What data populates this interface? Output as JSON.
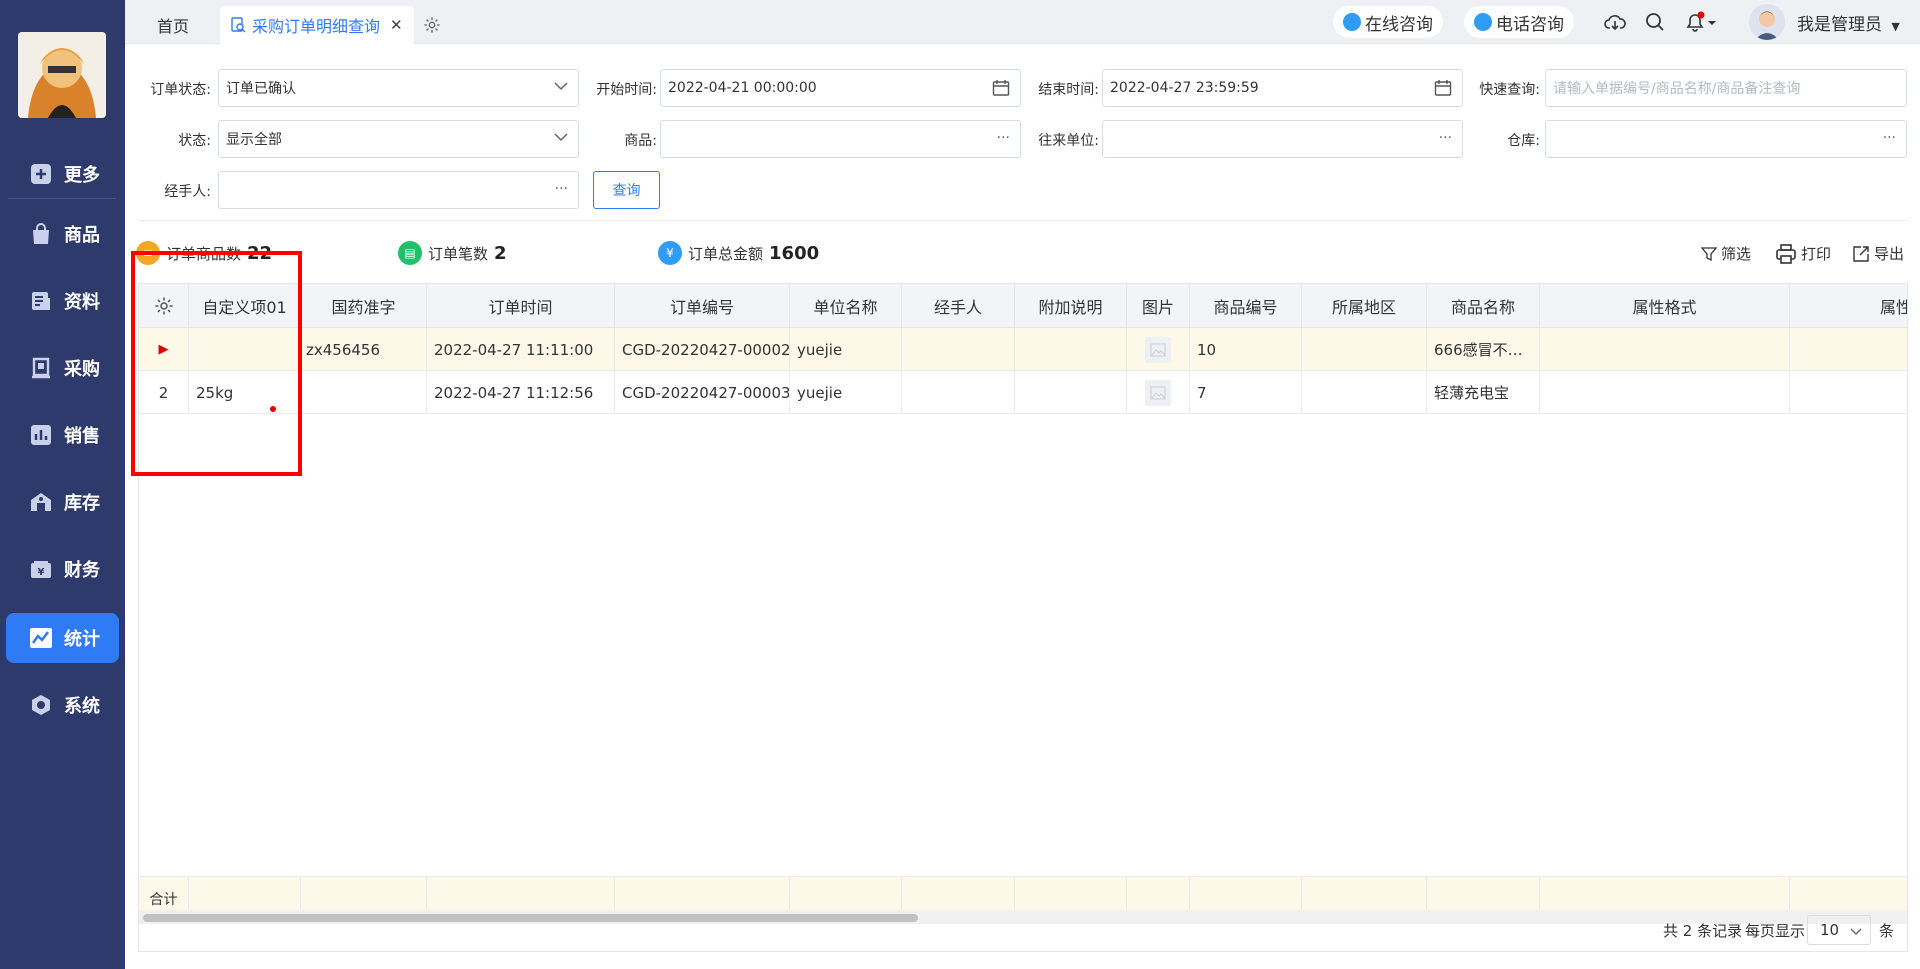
{
  "sidebar": {
    "items": [
      {
        "label": "更多",
        "icon": "plus-square-icon"
      },
      {
        "label": "商品",
        "icon": "shopping-bag-icon"
      },
      {
        "label": "资料",
        "icon": "document-icon"
      },
      {
        "label": "采购",
        "icon": "purchase-icon"
      },
      {
        "label": "销售",
        "icon": "bar-chart-icon"
      },
      {
        "label": "库存",
        "icon": "warehouse-icon"
      },
      {
        "label": "财务",
        "icon": "finance-icon"
      },
      {
        "label": "统计",
        "icon": "statistics-icon"
      },
      {
        "label": "系统",
        "icon": "settings-hex-icon"
      }
    ],
    "active": "统计"
  },
  "topbar": {
    "home_tab": "首页",
    "active_tab": "采购订单明细查询",
    "online_consult": "在线咨询",
    "phone_consult": "电话咨询",
    "user_name": "我是管理员"
  },
  "filters": {
    "order_status_label": "订单状态:",
    "order_status_value": "订单已确认",
    "start_time_label": "开始时间:",
    "start_time_value": "2022-04-21 00:00:00",
    "end_time_label": "结束时间:",
    "end_time_value": "2022-04-27 23:59:59",
    "quick_query_label": "快速查询:",
    "quick_query_placeholder": "请输入单据编号/商品名称/商品备注查询",
    "status_label": "状态:",
    "status_value": "显示全部",
    "goods_label": "商品:",
    "partner_label": "往来单位:",
    "warehouse_label": "仓库:",
    "handler_label": "经手人:",
    "query_button": "查询"
  },
  "stats": {
    "goods_count_label": "订单商品数",
    "goods_count": "22",
    "order_count_label": "订单笔数",
    "order_count": "2",
    "total_amount_label": "订单总金额",
    "total_amount": "1600"
  },
  "actions": {
    "filter": "筛选",
    "print": "打印",
    "export": "导出"
  },
  "table": {
    "headers": [
      "自定义项01",
      "国药准字",
      "订单时间",
      "订单编号",
      "单位名称",
      "经手人",
      "附加说明",
      "图片",
      "商品编号",
      "所属地区",
      "商品名称",
      "属性格式",
      "属性"
    ],
    "rows": [
      {
        "index": "",
        "custom01": "",
        "guoyao": "zx456456",
        "time": "2022-04-27 11:11:00",
        "order_no": "CGD-20220427-00002",
        "unit": "yuejie",
        "handler": "",
        "note": "",
        "goods_no": "10",
        "region": "",
        "goods_name": "666感冒不…",
        "attr": ""
      },
      {
        "index": "2",
        "custom01": "25kg",
        "guoyao": "",
        "time": "2022-04-27 11:12:56",
        "order_no": "CGD-20220427-00003",
        "unit": "yuejie",
        "handler": "",
        "note": "",
        "goods_no": "7",
        "region": "",
        "goods_name": "轻薄充电宝",
        "attr": ""
      }
    ],
    "sum_label": "合计"
  },
  "pager": {
    "total_text": "共 2 条记录",
    "per_page_label": "每页显示",
    "per_page_value": "10",
    "unit": "条"
  }
}
